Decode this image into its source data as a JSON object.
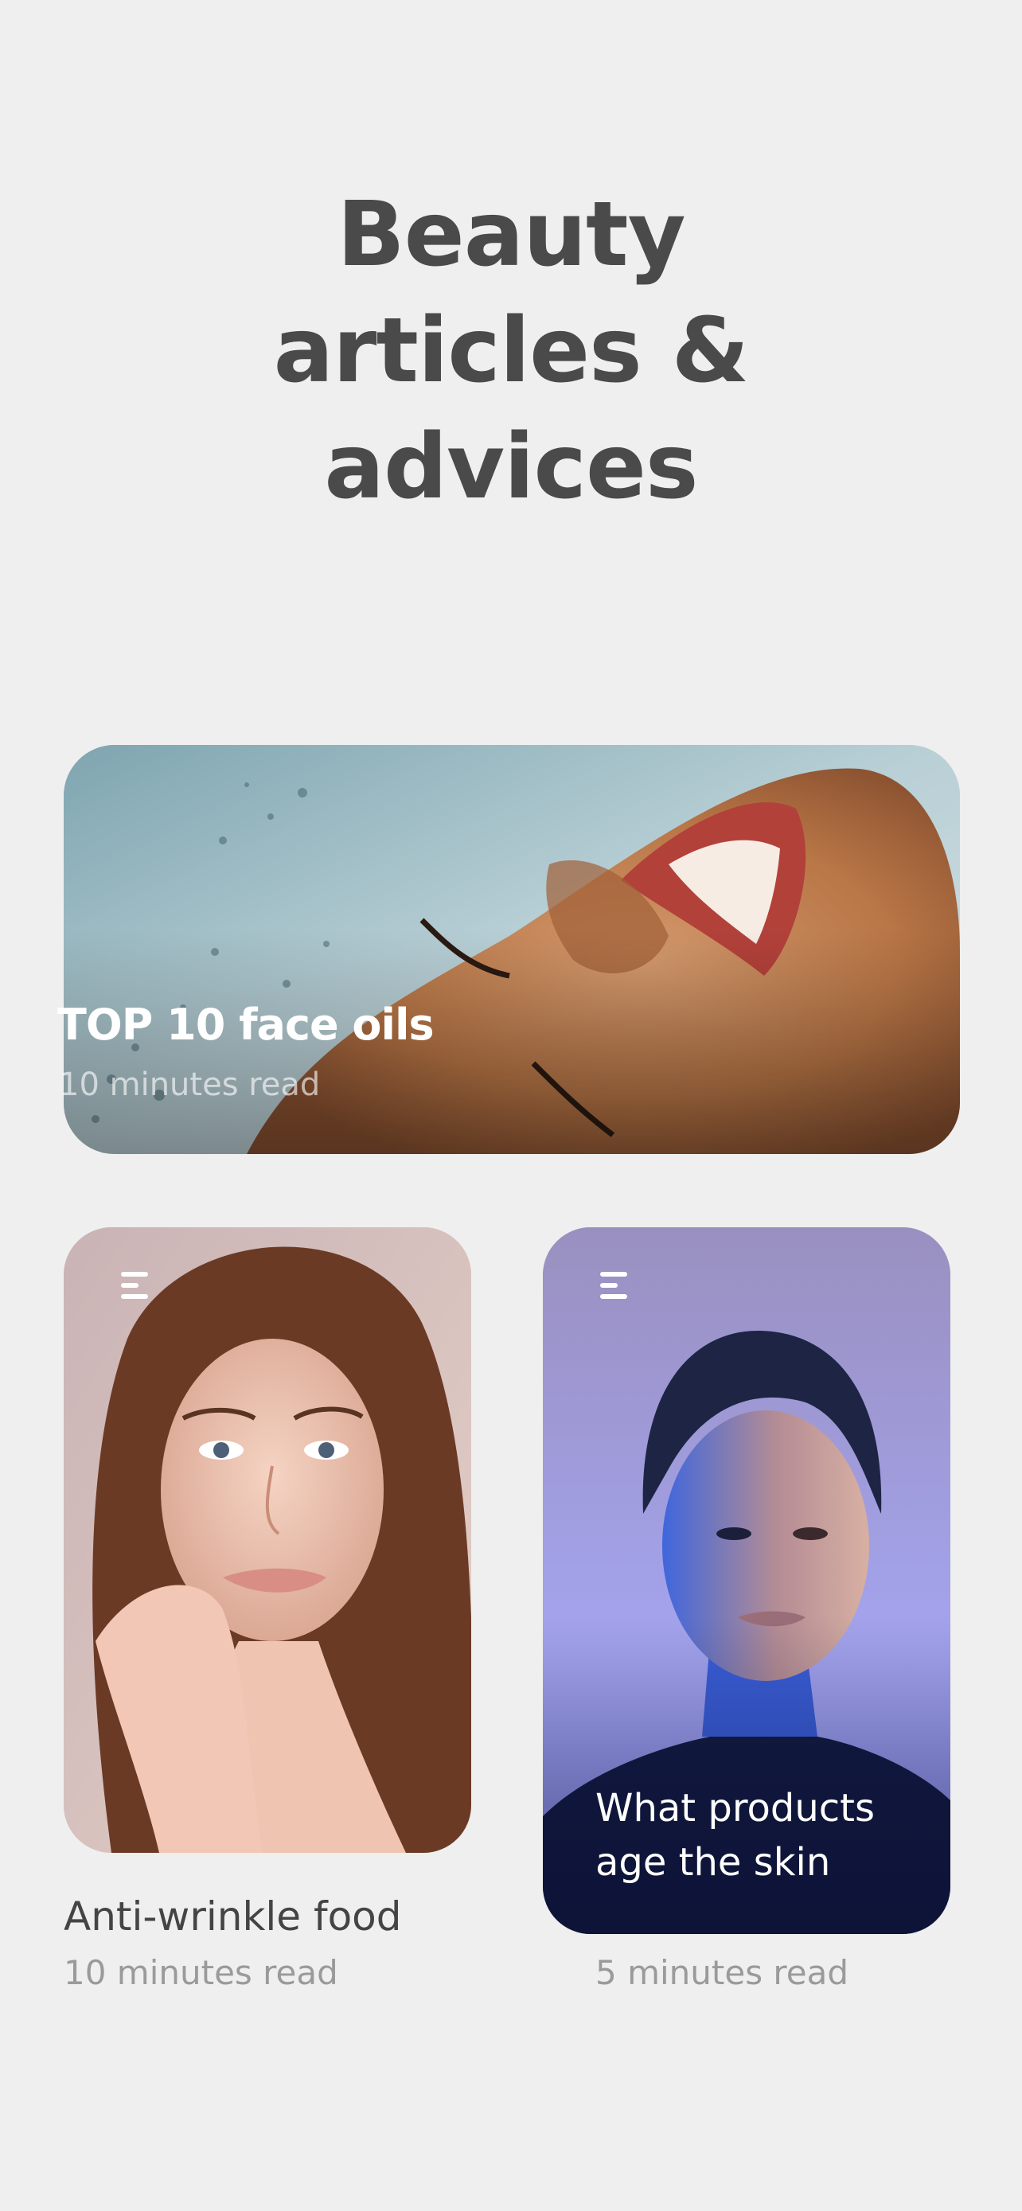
{
  "page": {
    "title_lines": [
      "Beauty",
      "articles &",
      "advices"
    ],
    "background": "#efefef",
    "title_color": "#4a4a4a"
  },
  "featured": {
    "title": "TOP 10 face oils",
    "read_time": "10 minutes read"
  },
  "articles": [
    {
      "title": "Anti-wrinkle food",
      "read_time": "10 minutes read",
      "menu_icon": "menu-icon"
    },
    {
      "title_lines": [
        "What products",
        "age the skin"
      ],
      "read_time": "5 minutes read",
      "menu_icon": "menu-icon"
    }
  ]
}
